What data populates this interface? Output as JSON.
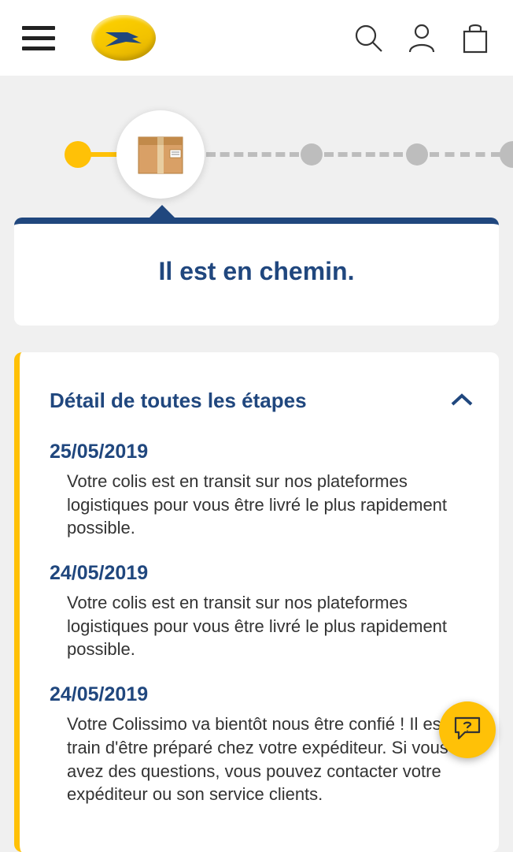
{
  "status": {
    "title": "Il est en chemin."
  },
  "details": {
    "title": "Détail de toutes les étapes",
    "events": [
      {
        "date": "25/05/2019",
        "text": "Votre colis est en transit sur nos plateformes logistiques pour vous être livré le plus rapidement possible."
      },
      {
        "date": "24/05/2019",
        "text": "Votre colis est en transit sur nos plateformes logistiques pour vous être livré le plus rapidement possible."
      },
      {
        "date": "24/05/2019",
        "text": "Votre Colissimo va bientôt nous être confié ! Il est en train d'être préparé chez votre expéditeur. Si vous avez des questions, vous pouvez contacter votre expéditeur ou son service clients."
      }
    ]
  }
}
